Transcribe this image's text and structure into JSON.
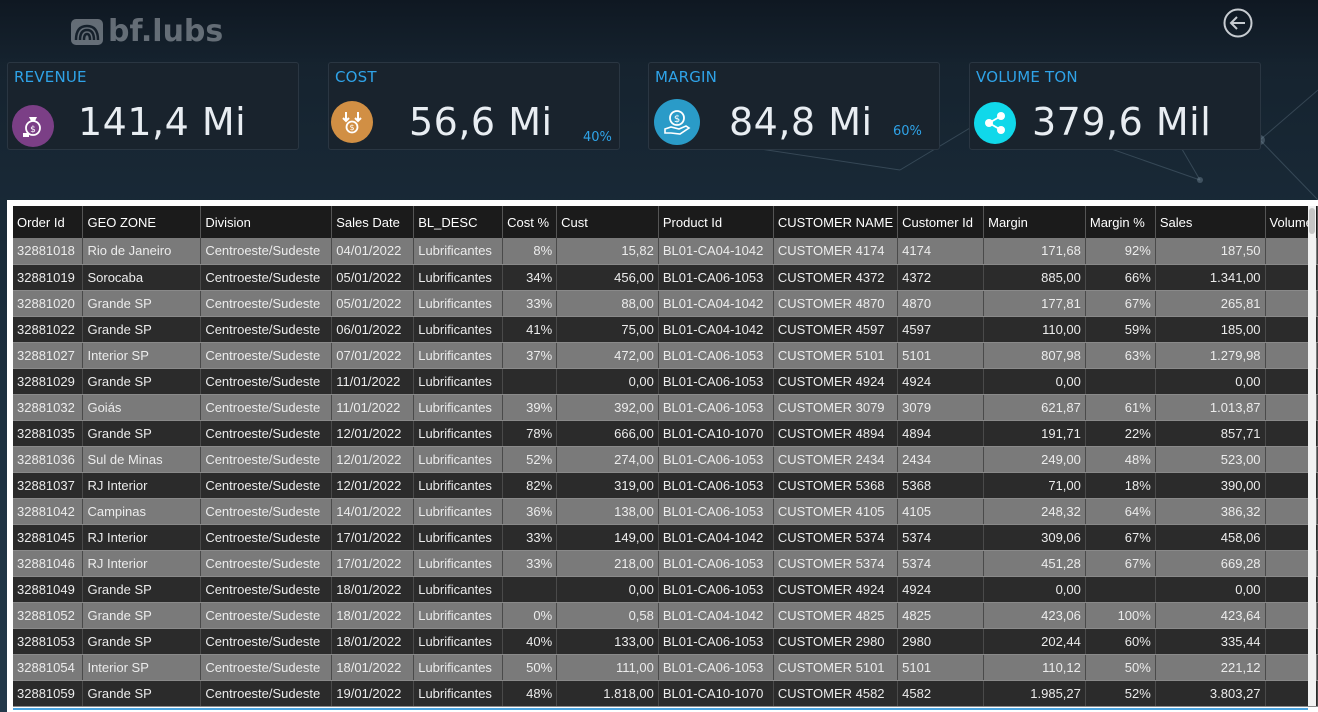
{
  "brand": {
    "logo_text": "bf.lubs"
  },
  "kpis": [
    {
      "title": "REVENUE",
      "value": "141,4 Mi",
      "pct": "",
      "icon": "money-bag-icon",
      "color": "#7b3f86"
    },
    {
      "title": "COST",
      "value": "56,6 Mi",
      "pct": "40%",
      "icon": "down-coin-icon",
      "color": "#d18f44"
    },
    {
      "title": "MARGIN",
      "value": "84,8 Mi",
      "pct": "60%",
      "icon": "hand-coin-icon",
      "color": "#2a9bc8"
    },
    {
      "title": "VOLUME TON",
      "value": "379,6 Mil",
      "pct": "",
      "icon": "share-coin-icon",
      "color": "#10d8ea"
    }
  ],
  "table": {
    "columns": [
      "Order Id",
      "GEO ZONE",
      "Division",
      "Sales Date",
      "BL_DESC",
      "Cost %",
      "Cust",
      "Product Id",
      "CUSTOMER NAME",
      "Customer Id",
      "Margin",
      "Margin %",
      "Sales",
      "Volume"
    ],
    "rows": [
      [
        "32881018",
        "Rio de Janeiro",
        "Centroeste/Sudeste",
        "04/01/2022",
        "Lubrificantes",
        "8%",
        "15,82",
        "BL01-CA04-1042",
        "CUSTOMER 4174",
        "4174",
        "171,68",
        "92%",
        "187,50",
        ""
      ],
      [
        "32881019",
        "Sorocaba",
        "Centroeste/Sudeste",
        "05/01/2022",
        "Lubrificantes",
        "34%",
        "456,00",
        "BL01-CA06-1053",
        "CUSTOMER 4372",
        "4372",
        "885,00",
        "66%",
        "1.341,00",
        ""
      ],
      [
        "32881020",
        "Grande SP",
        "Centroeste/Sudeste",
        "05/01/2022",
        "Lubrificantes",
        "33%",
        "88,00",
        "BL01-CA04-1042",
        "CUSTOMER 4870",
        "4870",
        "177,81",
        "67%",
        "265,81",
        ""
      ],
      [
        "32881022",
        "Grande SP",
        "Centroeste/Sudeste",
        "06/01/2022",
        "Lubrificantes",
        "41%",
        "75,00",
        "BL01-CA04-1042",
        "CUSTOMER 4597",
        "4597",
        "110,00",
        "59%",
        "185,00",
        ""
      ],
      [
        "32881027",
        "Interior SP",
        "Centroeste/Sudeste",
        "07/01/2022",
        "Lubrificantes",
        "37%",
        "472,00",
        "BL01-CA06-1053",
        "CUSTOMER 5101",
        "5101",
        "807,98",
        "63%",
        "1.279,98",
        ""
      ],
      [
        "32881029",
        "Grande SP",
        "Centroeste/Sudeste",
        "11/01/2022",
        "Lubrificantes",
        "",
        "0,00",
        "BL01-CA06-1053",
        "CUSTOMER 4924",
        "4924",
        "0,00",
        "",
        "0,00",
        ""
      ],
      [
        "32881032",
        "Goiás",
        "Centroeste/Sudeste",
        "11/01/2022",
        "Lubrificantes",
        "39%",
        "392,00",
        "BL01-CA06-1053",
        "CUSTOMER 3079",
        "3079",
        "621,87",
        "61%",
        "1.013,87",
        ""
      ],
      [
        "32881035",
        "Grande SP",
        "Centroeste/Sudeste",
        "12/01/2022",
        "Lubrificantes",
        "78%",
        "666,00",
        "BL01-CA10-1070",
        "CUSTOMER 4894",
        "4894",
        "191,71",
        "22%",
        "857,71",
        ""
      ],
      [
        "32881036",
        "Sul de Minas",
        "Centroeste/Sudeste",
        "12/01/2022",
        "Lubrificantes",
        "52%",
        "274,00",
        "BL01-CA06-1053",
        "CUSTOMER 2434",
        "2434",
        "249,00",
        "48%",
        "523,00",
        ""
      ],
      [
        "32881037",
        "RJ Interior",
        "Centroeste/Sudeste",
        "12/01/2022",
        "Lubrificantes",
        "82%",
        "319,00",
        "BL01-CA06-1053",
        "CUSTOMER 5368",
        "5368",
        "71,00",
        "18%",
        "390,00",
        ""
      ],
      [
        "32881042",
        "Campinas",
        "Centroeste/Sudeste",
        "14/01/2022",
        "Lubrificantes",
        "36%",
        "138,00",
        "BL01-CA06-1053",
        "CUSTOMER 4105",
        "4105",
        "248,32",
        "64%",
        "386,32",
        ""
      ],
      [
        "32881045",
        "RJ Interior",
        "Centroeste/Sudeste",
        "17/01/2022",
        "Lubrificantes",
        "33%",
        "149,00",
        "BL01-CA04-1042",
        "CUSTOMER 5374",
        "5374",
        "309,06",
        "67%",
        "458,06",
        ""
      ],
      [
        "32881046",
        "RJ Interior",
        "Centroeste/Sudeste",
        "17/01/2022",
        "Lubrificantes",
        "33%",
        "218,00",
        "BL01-CA06-1053",
        "CUSTOMER 5374",
        "5374",
        "451,28",
        "67%",
        "669,28",
        ""
      ],
      [
        "32881049",
        "Grande SP",
        "Centroeste/Sudeste",
        "18/01/2022",
        "Lubrificantes",
        "",
        "0,00",
        "BL01-CA06-1053",
        "CUSTOMER 4924",
        "4924",
        "0,00",
        "",
        "0,00",
        ""
      ],
      [
        "32881052",
        "Grande SP",
        "Centroeste/Sudeste",
        "18/01/2022",
        "Lubrificantes",
        "0%",
        "0,58",
        "BL01-CA04-1042",
        "CUSTOMER 4825",
        "4825",
        "423,06",
        "100%",
        "423,64",
        ""
      ],
      [
        "32881053",
        "Grande SP",
        "Centroeste/Sudeste",
        "18/01/2022",
        "Lubrificantes",
        "40%",
        "133,00",
        "BL01-CA06-1053",
        "CUSTOMER 2980",
        "2980",
        "202,44",
        "60%",
        "335,44",
        ""
      ],
      [
        "32881054",
        "Interior SP",
        "Centroeste/Sudeste",
        "18/01/2022",
        "Lubrificantes",
        "50%",
        "111,00",
        "BL01-CA06-1053",
        "CUSTOMER 5101",
        "5101",
        "110,12",
        "50%",
        "221,12",
        ""
      ],
      [
        "32881059",
        "Grande SP",
        "Centroeste/Sudeste",
        "19/01/2022",
        "Lubrificantes",
        "48%",
        "1.818,00",
        "BL01-CA10-1070",
        "CUSTOMER 4582",
        "4582",
        "1.985,27",
        "52%",
        "3.803,27",
        ""
      ]
    ]
  }
}
